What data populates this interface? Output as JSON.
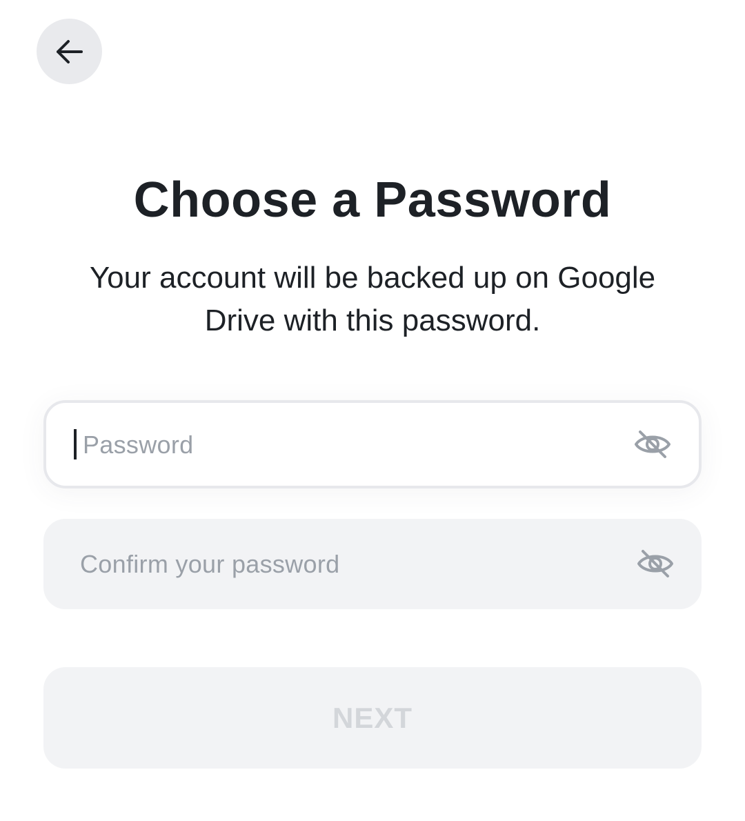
{
  "header": {
    "back_icon": "arrow-left-icon"
  },
  "page": {
    "title": "Choose a Password",
    "subtitle": "Your account will be backed up on Google Drive with this password."
  },
  "form": {
    "password": {
      "value": "",
      "placeholder": "Password",
      "toggle_icon": "eye-off-icon",
      "focused": true
    },
    "confirm_password": {
      "value": "",
      "placeholder": "Confirm your password",
      "toggle_icon": "eye-off-icon",
      "focused": false
    }
  },
  "actions": {
    "next_label": "NEXT",
    "next_enabled": false
  },
  "colors": {
    "text_primary": "#1d2126",
    "placeholder": "#9aa0a8",
    "button_disabled_bg": "#f2f3f5",
    "button_disabled_text": "#d3d6da",
    "back_button_bg": "#e9eaed"
  }
}
